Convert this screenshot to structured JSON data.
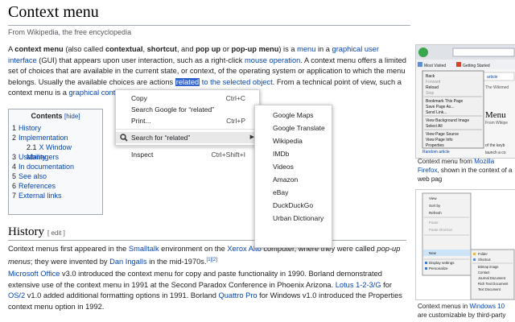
{
  "article": {
    "title": "Context menu",
    "tagline": "From Wikipedia, the free encyclopedia",
    "intro": {
      "s1": "A ",
      "b1": "context menu",
      "s2": " (also called ",
      "b2": "contextual",
      "s3": ", ",
      "b3": "shortcut",
      "s4": ", and ",
      "b4": "pop up",
      "s5": " or ",
      "b5": "pop-up menu",
      "s6": ") is a ",
      "l1": "menu",
      "s7": " in a ",
      "l2": "graphical user interface",
      "s8": " (GUI) that appears upon user interaction, such as a right-click ",
      "l3": "mouse operation",
      "s9": ". A context menu offers a limited set of choices that are available in the current state, or context, of the operating system or application to which the menu belongs. Usually the available choices are actions ",
      "selected": "related",
      "s10": " ",
      "l4": "to the selected object",
      "s11": ". From a technical point of view, such a context menu is a ",
      "l5": "graphical control element",
      "s12": "."
    },
    "toc": {
      "title": "Contents",
      "hide": "[hide]",
      "items": [
        {
          "num": "1",
          "label": "History"
        },
        {
          "num": "2",
          "label": "Implementation"
        },
        {
          "num": "2.1",
          "label": "X Window Managers"
        },
        {
          "num": "3",
          "label": "Usability"
        },
        {
          "num": "4",
          "label": "In documentation"
        },
        {
          "num": "5",
          "label": "See also"
        },
        {
          "num": "6",
          "label": "References"
        },
        {
          "num": "7",
          "label": "External links"
        }
      ]
    },
    "history": {
      "heading": "History",
      "edit": "[ edit ]",
      "p1": {
        "s1": "Context menus first appeared in the ",
        "l1": "Smalltalk",
        "s2": " environment on the ",
        "l2": "Xerox Alto",
        "s3": " computer, where they were called ",
        "i1": "pop-up menus",
        "s4": "; they were invented by ",
        "l3": "Dan Ingalls",
        "s5": " in the mid-1970s.",
        "ref": "[1][2]"
      },
      "p2": {
        "l1": "Microsoft Office",
        "s1": " v3.0 introduced the context menu for copy and paste functionality in 1990. Borland demonstrated extensive use of the context menu in 1991 at the Second Paradox Conference in Phoenix Arizona. ",
        "l2": "Lotus 1-2-3/G",
        "s2": " for ",
        "l3": "OS/2",
        "s3": " v1.0 added additional formatting options in 1991. Borland ",
        "l4": "Quattro Pro",
        "s4": " for Windows v1.0 introduced the Properties context menu option in 1992."
      }
    },
    "figure1_caption": {
      "s1": "Context menu from ",
      "l1": "Mozilla Firefox",
      "s2": ", shown in the context of a web pag"
    },
    "figure2_caption": {
      "s1": "Context menus in ",
      "l1": "Windows 10",
      "s2": " are customizable by third-party"
    }
  },
  "context_menu": {
    "items": [
      {
        "label": "Copy",
        "shortcut": "Ctrl+C"
      },
      {
        "label": "Search Google for “related”",
        "shortcut": ""
      },
      {
        "label": "Print...",
        "shortcut": "Ctrl+P"
      }
    ],
    "search_item": "Search for “related”",
    "inspect": {
      "label": "Inspect",
      "shortcut": "Ctrl+Shift+I"
    }
  },
  "submenu": {
    "items": [
      "Google Maps",
      "Google Translate",
      "Wikipedia",
      "IMDb",
      "Videos",
      "Amazon",
      "eBay",
      "DuckDuckGo",
      "Urban Dictionary"
    ]
  },
  "figure1_ui": {
    "bookmarks": [
      "Most Visited",
      "Getting Started"
    ],
    "tab_label": "article",
    "heading_fragment": "Menu",
    "sub_fragment": "From Wikipe",
    "side_fragment1": "The Wikimed",
    "side_fragment2": "of the keyb",
    "side_fragment3": "launch a co",
    "random_link": "Random article",
    "menu": [
      "Back",
      "Forward",
      "Reload",
      "Stop",
      "Bookmark This Page",
      "Save Page As...",
      "Send Link...",
      "View Background Image",
      "Select All",
      "View Page Source",
      "View Page Info",
      "Properties"
    ]
  },
  "figure2_ui": {
    "menu": [
      "View",
      "Sort by",
      "Refresh",
      "Paste",
      "Paste shortcut",
      "New",
      "Display settings",
      "Personalize"
    ],
    "sub": [
      "Folder",
      "Shortcut",
      "Bitmap image",
      "Contact",
      "Journal Document",
      "Rich Text Document",
      "Text Document"
    ]
  },
  "colors": {
    "link": "#0645ad",
    "selection": "#3366cc",
    "rule": "#a2a9b1"
  }
}
